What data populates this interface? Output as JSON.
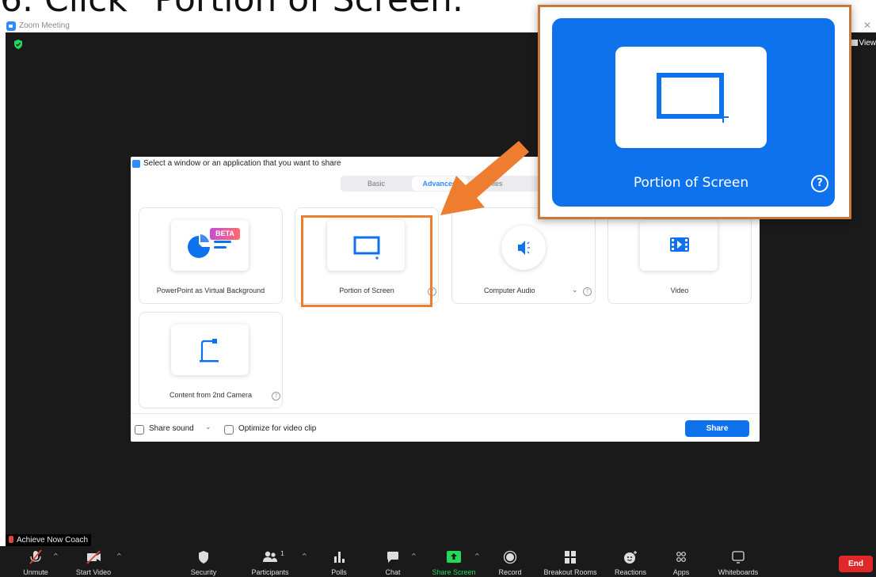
{
  "heading": "6. Click \"Portion of Screen.\"",
  "window": {
    "title": "Zoom Meeting",
    "view_label": "View"
  },
  "dialog": {
    "title": "Select a window or an application that you want to share",
    "tabs": [
      {
        "label": "Basic",
        "selected": false
      },
      {
        "label": "Advanced",
        "selected": true
      },
      {
        "label": "Files",
        "selected": false
      }
    ],
    "options": [
      {
        "label": "PowerPoint as Virtual Background",
        "badge": "BETA",
        "icon": "powerpoint-pie-icon"
      },
      {
        "label": "Portion of Screen",
        "icon": "portion-of-screen-icon",
        "selected": true
      },
      {
        "label": "Computer Audio",
        "icon": "speaker-icon"
      },
      {
        "label": "Video",
        "icon": "video-film-icon"
      },
      {
        "label": "Content from 2nd Camera",
        "icon": "document-camera-icon"
      }
    ],
    "share_sound_label": "Share sound",
    "optimize_label": "Optimize for video clip",
    "share_button": "Share"
  },
  "callout": {
    "label": "Portion of Screen",
    "help": "?"
  },
  "participant_name": "Achieve Now Coach",
  "toolbar": {
    "items": [
      {
        "label": "Unmute",
        "icon": "mic-muted-icon"
      },
      {
        "label": "Start Video",
        "icon": "video-off-icon"
      },
      {
        "label": "Security",
        "icon": "shield-icon"
      },
      {
        "label": "Participants",
        "icon": "participants-icon",
        "count": "1"
      },
      {
        "label": "Polls",
        "icon": "polls-icon"
      },
      {
        "label": "Chat",
        "icon": "chat-icon"
      },
      {
        "label": "Share Screen",
        "icon": "share-screen-icon",
        "active": true
      },
      {
        "label": "Record",
        "icon": "record-icon"
      },
      {
        "label": "Breakout Rooms",
        "icon": "breakout-rooms-icon"
      },
      {
        "label": "Reactions",
        "icon": "reactions-icon"
      },
      {
        "label": "Apps",
        "icon": "apps-icon"
      },
      {
        "label": "Whiteboards",
        "icon": "whiteboard-icon"
      }
    ],
    "end_label": "End"
  },
  "colors": {
    "accent": "#0e72ed",
    "highlight": "#ef7d2f",
    "share_active": "#23d959",
    "end": "#e02828",
    "meeting_bg": "#1a1a1a"
  }
}
